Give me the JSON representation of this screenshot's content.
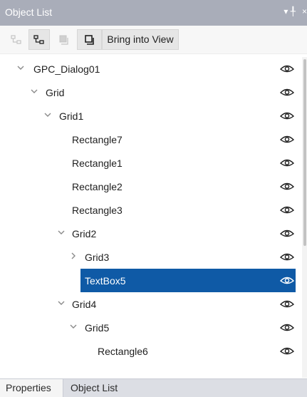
{
  "window": {
    "title": "Object List",
    "pin_glyph": "▾ ╀",
    "close_glyph": "×"
  },
  "toolbar": {
    "buttons": [
      {
        "icon": "collapse-hierarchy-icon",
        "enabled": false
      },
      {
        "icon": "expand-hierarchy-icon",
        "enabled": true
      },
      {
        "icon": "bring-to-front-icon",
        "enabled": false
      },
      {
        "icon": "send-to-back-icon",
        "enabled": true
      }
    ],
    "bring_into_view_label": "Bring into View"
  },
  "tree": {
    "items": [
      {
        "label": "GPC_Dialog01",
        "level": 0,
        "expander": "expanded",
        "visible": true
      },
      {
        "label": "Grid",
        "level": 1,
        "expander": "expanded",
        "visible": true
      },
      {
        "label": "Grid1",
        "level": 2,
        "expander": "expanded",
        "visible": true
      },
      {
        "label": "Rectangle7",
        "level": 3,
        "expander": "none",
        "visible": true
      },
      {
        "label": "Rectangle1",
        "level": 3,
        "expander": "none",
        "visible": true
      },
      {
        "label": "Rectangle2",
        "level": 3,
        "expander": "none",
        "visible": true
      },
      {
        "label": "Rectangle3",
        "level": 3,
        "expander": "none",
        "visible": true
      },
      {
        "label": "Grid2",
        "level": 3,
        "expander": "expanded",
        "visible": true
      },
      {
        "label": "Grid3",
        "level": 4,
        "expander": "collapsed",
        "visible": true
      },
      {
        "label": "TextBox5",
        "level": 4,
        "expander": "none",
        "visible": true,
        "selected": true
      },
      {
        "label": "Grid4",
        "level": 3,
        "expander": "expanded",
        "visible": true
      },
      {
        "label": "Grid5",
        "level": 4,
        "expander": "expanded",
        "visible": true
      },
      {
        "label": "Rectangle6",
        "level": 5,
        "expander": "none",
        "visible": true
      }
    ]
  },
  "bottom_tabs": [
    {
      "label": "Properties",
      "active": true
    },
    {
      "label": "Object List",
      "active": false
    }
  ],
  "colors": {
    "title_bg": "#a9adb9",
    "selection_bg": "#0f5aa6",
    "selection_text": "#ffffff"
  }
}
